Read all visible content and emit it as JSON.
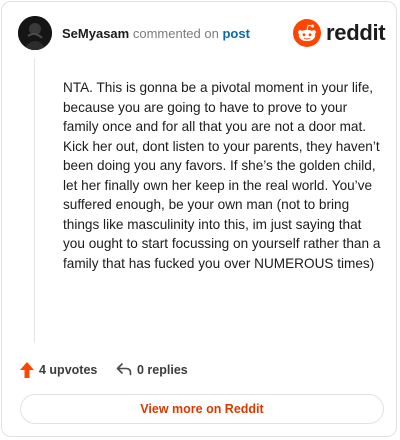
{
  "header": {
    "username": "SeMyasam",
    "action": "commented on",
    "post_link": "post",
    "brand_wordmark": "reddit"
  },
  "comment": {
    "text": "NTA. This is gonna be a pivotal moment in your life, because you are going to have to prove to your family once and for all that you are not a door mat. Kick her out, dont listen to your parents, they haven’t been doing you any favors. If she’s the golden child, let her finally own her keep in the real world. You’ve suffered enough, be your own man (not to bring things like masculinity into this, im just saying that you ought to start focussing on yourself rather than a family that has fucked you over NUMEROUS times)"
  },
  "stats": {
    "upvotes_label": "4 upvotes",
    "replies_label": "0 replies"
  },
  "footer": {
    "view_more_label": "View more on Reddit"
  },
  "icons": {
    "brand": "reddit-logo-icon",
    "upvote": "upvote-arrow-icon",
    "reply": "reply-arrow-icon"
  },
  "colors": {
    "brand_orange": "#ff4500",
    "upvote_orange": "#ff4500",
    "link_blue": "#0a6aa8",
    "view_more_text": "#d93a00"
  }
}
